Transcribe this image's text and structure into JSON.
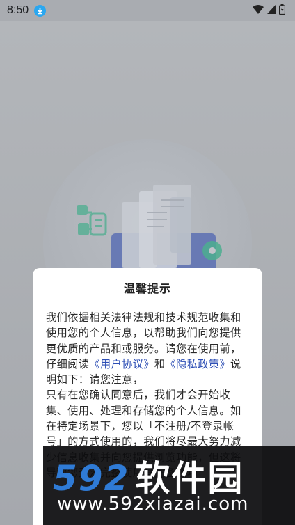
{
  "status_bar": {
    "time": "8:50",
    "icons": [
      "download-icon",
      "wifi-icon",
      "signal-icon",
      "battery-icon"
    ]
  },
  "dialog": {
    "title": "温馨提示",
    "para_part1": "我们依据相关法律法规和技术规范收集和使用您的个人信息，以帮助我们向您提供更优质的产品和或服务。请您在使用前，仔细阅读",
    "link_user_agreement": "《用户协议》",
    "and_text": "和",
    "link_privacy_policy": "《隐私政策》",
    "para_part2": "说明如下：请您注意，",
    "para_line2": "只有在您确认同意后，我们才会开始收集、使用、处理和存储您的个人信息。如在特定场景下，您以「不注册/不登录帐号」的方式使用的，我们将尽最大努力减少信息收集并向您提供浏览功能，但这将导致您无法完整使用其完备项功"
  },
  "watermark": {
    "logo_number": "592",
    "logo_text": "软件园",
    "url": "www.592xiazai.com"
  },
  "colors": {
    "link": "#2e4fb5",
    "download_badge": "#2aa7f0",
    "watermark_blue": "#2f7bd6"
  }
}
